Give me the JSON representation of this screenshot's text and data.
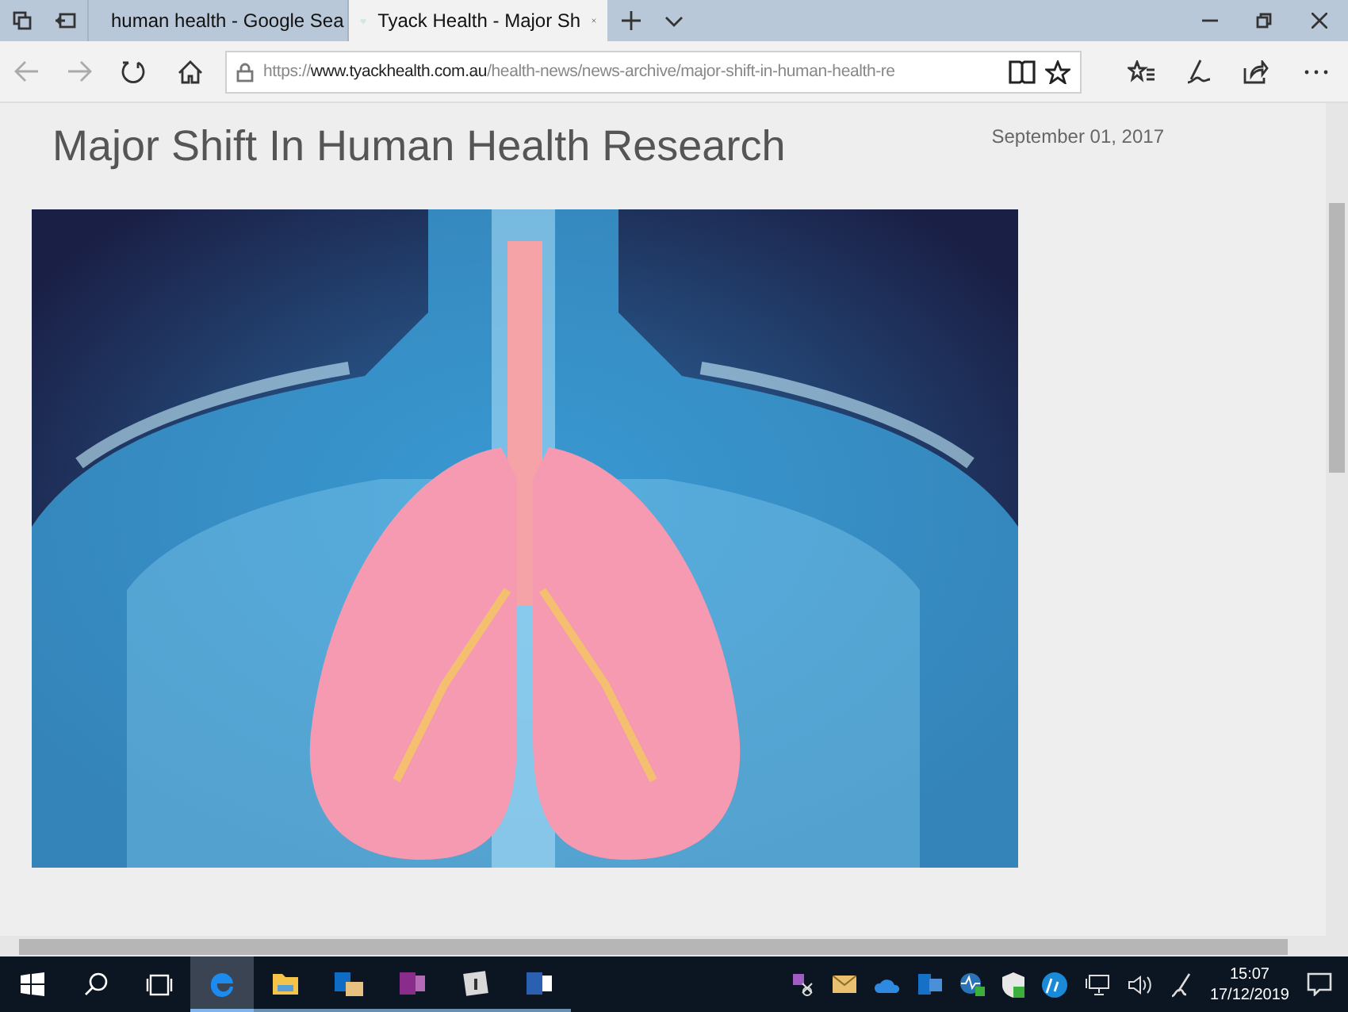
{
  "tabs": [
    {
      "kind": "google",
      "title": "human health - Google Sea",
      "selected": false
    },
    {
      "kind": "site",
      "title": "Tyack Health - Major Sh",
      "selected": true
    }
  ],
  "address": {
    "scheme": "https://",
    "domain": "www.tyackhealth.com.au",
    "path": "/health-news/news-archive/major-shift-in-human-health-re"
  },
  "article": {
    "title": "Major Shift In Human Health Research",
    "date": "September 01, 2017"
  },
  "taskbar": {
    "apps": [
      {
        "kind": "edge",
        "selected": true
      },
      {
        "kind": "folder",
        "selected": false
      },
      {
        "kind": "outlook",
        "selected": false
      },
      {
        "kind": "onenote",
        "selected": false
      },
      {
        "kind": "generic",
        "selected": false
      },
      {
        "kind": "word",
        "selected": false
      }
    ],
    "time": "15:07",
    "date": "17/12/2019"
  }
}
